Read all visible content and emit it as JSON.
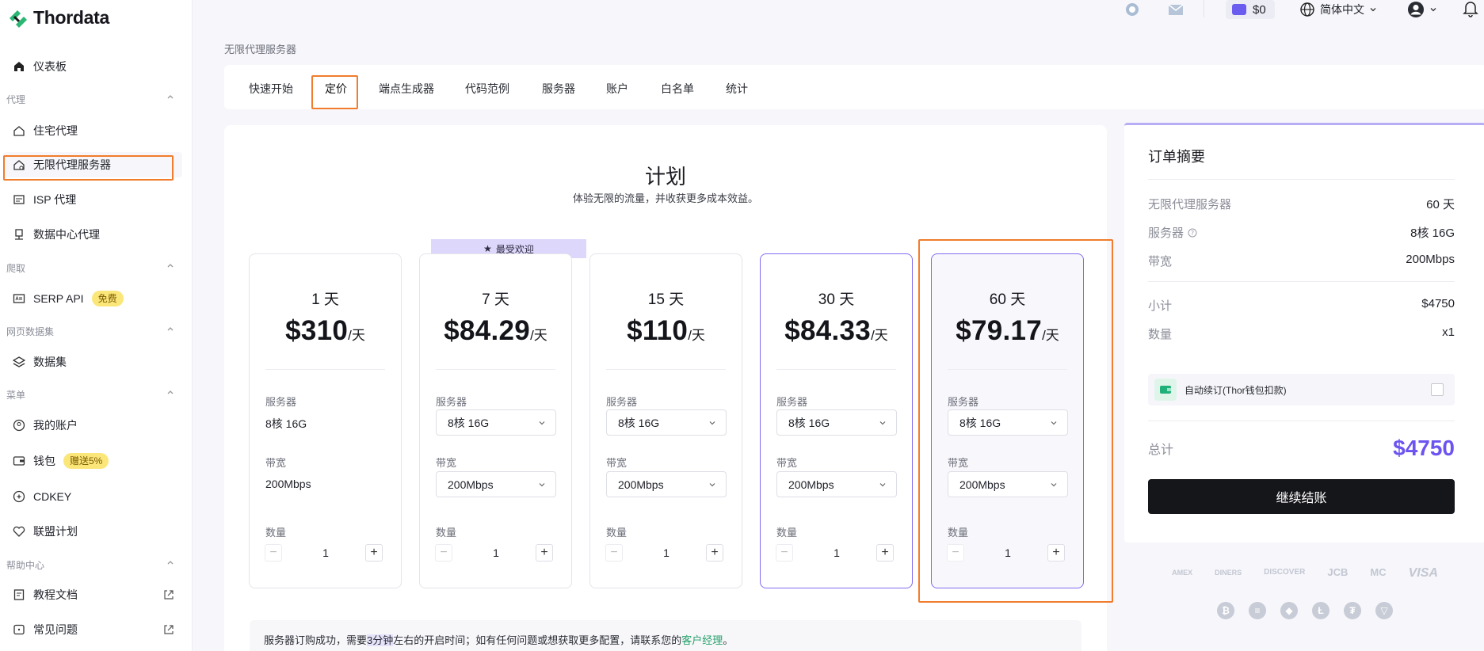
{
  "app": {
    "logo_text": "Thordata"
  },
  "sidebar": {
    "dashboard": "仪表板",
    "groups": {
      "proxy": "代理",
      "scrape": "爬取",
      "dataset": "网页数据集",
      "menu": "菜单",
      "help": "帮助中心"
    },
    "items": {
      "residential": "住宅代理",
      "unlimited": "无限代理服务器",
      "isp": "ISP 代理",
      "datacenter": "数据中心代理",
      "serp": "SERP API",
      "serp_badge": "免费",
      "datasets": "数据集",
      "account": "我的账户",
      "wallet": "钱包",
      "wallet_badge": "赠送5%",
      "cdkey": "CDKEY",
      "affiliate": "联盟计划",
      "docs": "教程文档",
      "faq": "常见问题"
    }
  },
  "topbar": {
    "balance": "$0",
    "language": "简体中文"
  },
  "breadcrumb": "无限代理服务器",
  "tabs": [
    "快速开始",
    "定价",
    "端点生成器",
    "代码范例",
    "服务器",
    "账户",
    "白名单",
    "统计"
  ],
  "plans": {
    "title": "计划",
    "subtitle": "体验无限的流量，并收获更多成本效益。",
    "popular_label": "最受欢迎",
    "server_label": "服务器",
    "bandwidth_label": "带宽",
    "qty_label": "数量",
    "per_day": "/天",
    "cards": [
      {
        "days": "1 天",
        "price": "$310",
        "server": "8核 16G",
        "bandwidth": "200Mbps",
        "qty": "1"
      },
      {
        "days": "7 天",
        "price": "$84.29",
        "server": "8核 16G",
        "bandwidth": "200Mbps",
        "qty": "1"
      },
      {
        "days": "15 天",
        "price": "$110",
        "server": "8核 16G",
        "bandwidth": "200Mbps",
        "qty": "1"
      },
      {
        "days": "30 天",
        "price": "$84.33",
        "server": "8核 16G",
        "bandwidth": "200Mbps",
        "qty": "1"
      },
      {
        "days": "60 天",
        "price": "$79.17",
        "server": "8核 16G",
        "bandwidth": "200Mbps",
        "qty": "1"
      }
    ],
    "notice_pre": "服务器订购成功，需要",
    "notice_hl": "3分钟",
    "notice_mid": "左右的开启时间；如有任何问题或想获取更多配置，请联系您的",
    "notice_link": "客户经理",
    "notice_end": "。"
  },
  "summary": {
    "title": "订单摘要",
    "rows": [
      {
        "k": "无限代理服务器",
        "v": "60 天"
      },
      {
        "k": "服务器",
        "v": "8核 16G"
      },
      {
        "k": "带宽",
        "v": "200Mbps"
      },
      {
        "k": "小计",
        "v": "$4750"
      },
      {
        "k": "数量",
        "v": "x1"
      }
    ],
    "auto_renew": "自动续订(Thor钱包扣款)",
    "total_label": "总计",
    "total_value": "$4750",
    "checkout": "继续结账"
  },
  "payment": {
    "cards": [
      "AMEX",
      "DINERS",
      "DISCOVER",
      "JCB",
      "MC",
      "VISA"
    ],
    "coins": [
      "₿",
      "≡",
      "◆",
      "Ł",
      "₮",
      "▽"
    ]
  },
  "colors": {
    "accent": "#6b54f0",
    "highlight": "#f07c2c",
    "ribbon": "#ddd7fb"
  }
}
